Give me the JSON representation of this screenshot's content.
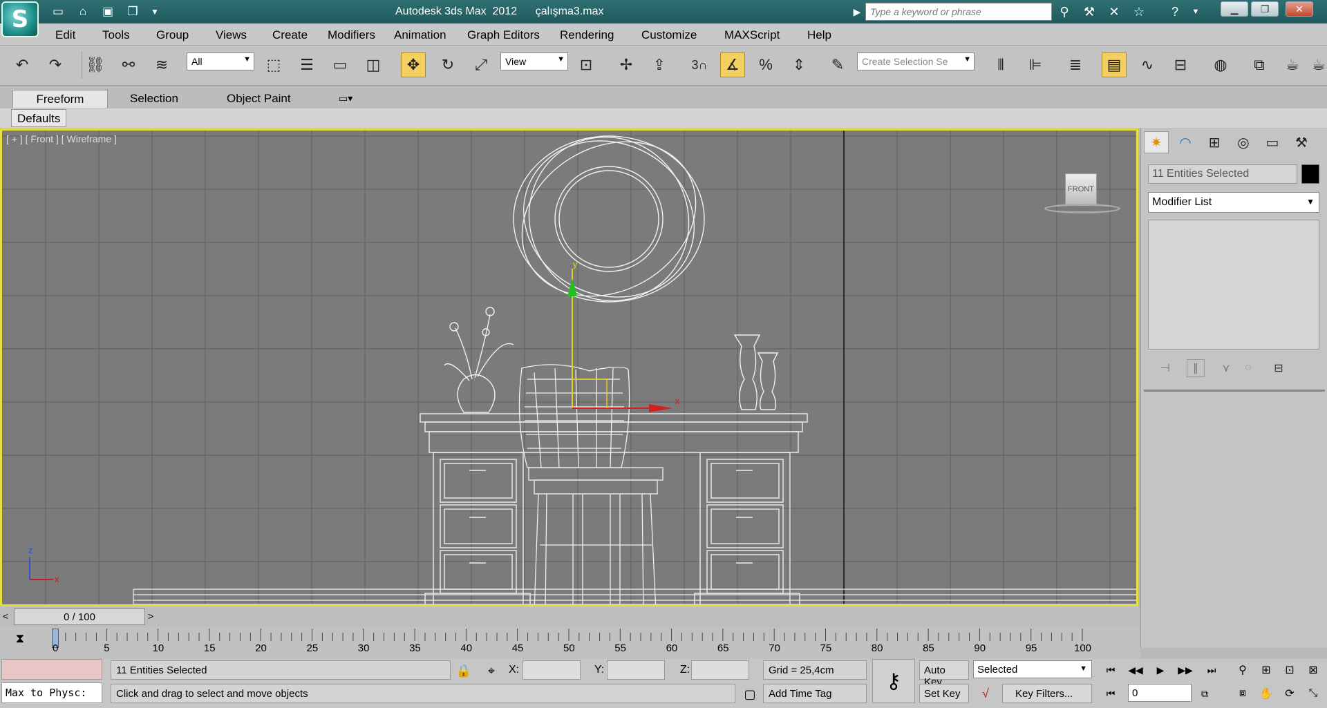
{
  "window": {
    "title": "Autodesk 3ds Max  2012      çalışma3.max",
    "search_placeholder": "Type a keyword or phrase"
  },
  "menu": [
    "Edit",
    "Tools",
    "Group",
    "Views",
    "Create",
    "Modifiers",
    "Animation",
    "Graph Editors",
    "Rendering",
    "Customize",
    "MAXScript",
    "Help"
  ],
  "toolbar": {
    "filter_value": "All",
    "ref_coord_value": "View",
    "snap_label": "3",
    "selection_set_placeholder": "Create Selection Se"
  },
  "ribbon": {
    "tabs": [
      "Freeform",
      "Selection",
      "Object Paint"
    ],
    "defaults_tab": "Defaults"
  },
  "viewport": {
    "label": "[ + ] [ Front ] [ Wireframe ]",
    "view_cube_label": "FRONT",
    "axis_z": "z",
    "axis_x": "x",
    "gizmo_x": "x",
    "gizmo_y": "y"
  },
  "command_panel": {
    "name_field": "11 Entities Selected",
    "modifier_list": "Modifier List"
  },
  "time_slider": {
    "left_arrow": "<",
    "frame_display": "0 / 100",
    "right_arrow": ">"
  },
  "track": {
    "ticks": [
      "0",
      "5",
      "10",
      "15",
      "20",
      "25",
      "30",
      "35",
      "40",
      "45",
      "50",
      "55",
      "60",
      "65",
      "70",
      "75",
      "80",
      "85",
      "90",
      "95",
      "100"
    ]
  },
  "status": {
    "maxscript_listener": "Max to Physc:",
    "selection_text": "11 Entities Selected",
    "prompt_text": "Click and drag to select and move objects",
    "x_label": "X:",
    "y_label": "Y:",
    "z_label": "Z:",
    "grid_text": "Grid = 25,4cm",
    "add_time_tag": "Add Time Tag",
    "auto_key": "Auto Key",
    "set_key": "Set Key",
    "selected_value": "Selected",
    "key_filters": "Key Filters...",
    "current_frame": "0"
  },
  "colors": {
    "viewport_border": "#e6e13c",
    "viewport_bg": "#7b7b7b",
    "title_bar": "#2f6f72"
  }
}
